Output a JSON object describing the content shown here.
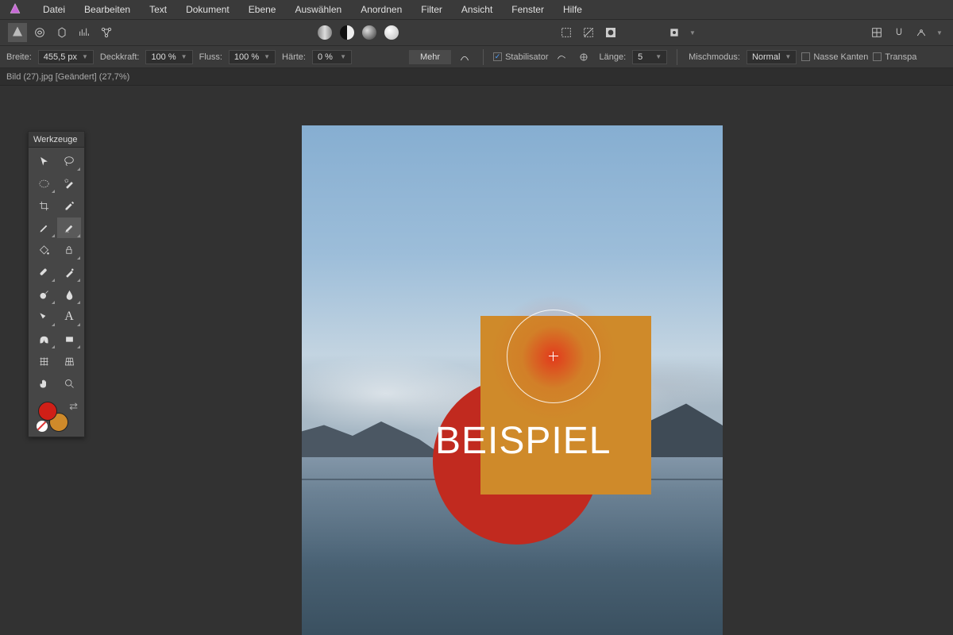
{
  "menu": [
    "Datei",
    "Bearbeiten",
    "Text",
    "Dokument",
    "Ebene",
    "Auswählen",
    "Anordnen",
    "Filter",
    "Ansicht",
    "Fenster",
    "Hilfe"
  ],
  "ctx": {
    "breite_lbl": "Breite:",
    "breite_val": "455,5 px",
    "deckkraft_lbl": "Deckkraft:",
    "deckkraft_val": "100 %",
    "fluss_lbl": "Fluss:",
    "fluss_val": "100 %",
    "haerte_lbl": "Härte:",
    "haerte_val": "0 %",
    "mehr": "Mehr",
    "stabilisator": "Stabilisator",
    "laenge_lbl": "Länge:",
    "laenge_val": "5",
    "misch_lbl": "Mischmodus:",
    "misch_val": "Normal",
    "nasse": "Nasse Kanten",
    "transp": "Transpa"
  },
  "tab": "Bild (27).jpg [Geändert] (27,7%)",
  "tools_title": "Werkzeuge",
  "colors": {
    "fg": "#d01f17",
    "bg": "#cf8a2a"
  },
  "canvas": {
    "text": "BEISPIEL",
    "circle_color": "#c12a1f",
    "rect_color": "#cf8a2a"
  }
}
